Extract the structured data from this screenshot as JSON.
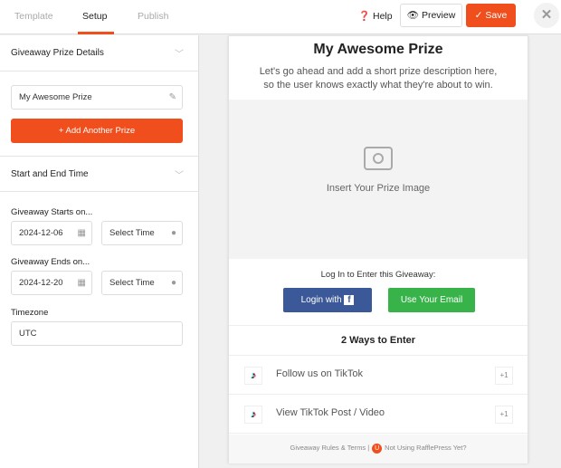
{
  "tabs": [
    {
      "label": "Template"
    },
    {
      "label": "Setup"
    },
    {
      "label": "Publish"
    }
  ],
  "header": {
    "help": "Help",
    "preview": "Preview",
    "save": "Save"
  },
  "sidebar": {
    "prize_section": "Giveaway Prize Details",
    "prize_name": "My Awesome Prize",
    "add_prize": "Add Another Prize",
    "time_section": "Start and End Time",
    "starts_label": "Giveaway Starts on...",
    "start_date": "2024-12-06",
    "start_time": "Select Time",
    "ends_label": "Giveaway Ends on...",
    "end_date": "2024-12-20",
    "end_time": "Select Time",
    "timezone_label": "Timezone",
    "timezone": "UTC"
  },
  "preview": {
    "title": "My Awesome Prize",
    "desc1": "Let's go ahead and add a short prize description here,",
    "desc2": "so the user knows exactly what they're about to win.",
    "image_placeholder": "Insert Your Prize Image",
    "login_prompt": "Log In to Enter this Giveaway:",
    "login_fb": "Login with",
    "login_email": "Use Your Email",
    "ways": "2 Ways to Enter",
    "entries": [
      {
        "label": "Follow us on TikTok",
        "points": "+1"
      },
      {
        "label": "View TikTok Post / Video",
        "points": "+1"
      }
    ],
    "rules": "Giveaway Rules & Terms |",
    "not_using": "Not Using RafflePress Yet?"
  },
  "colors": {
    "accent": "#f04e1d",
    "facebook": "#3b5998",
    "email": "#37b34a"
  }
}
